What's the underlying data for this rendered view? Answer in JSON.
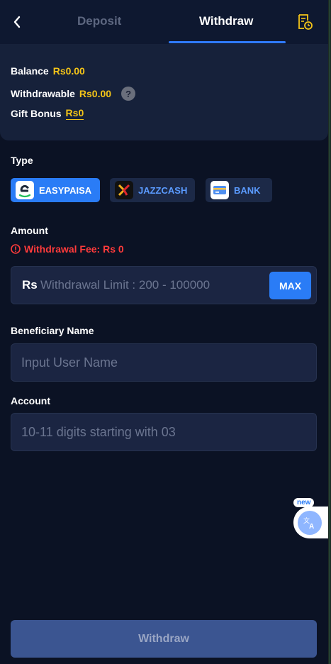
{
  "header": {
    "tabs": [
      {
        "label": "Deposit",
        "active": false
      },
      {
        "label": "Withdraw",
        "active": true
      }
    ],
    "back_icon": "chevron-left-icon",
    "record_icon": "withdraw-history-icon",
    "accent_color": "#2f7bff"
  },
  "balance": {
    "balance_label": "Balance",
    "balance_value": "Rs0.00",
    "withdrawable_label": "Withdrawable",
    "withdrawable_value": "Rs0.00",
    "help_glyph": "?",
    "gift_label": "Gift Bonus",
    "gift_value": "Rs0",
    "value_color": "#f5c518"
  },
  "type": {
    "label": "Type",
    "options": [
      {
        "label": "EASYPAISA",
        "selected": true
      },
      {
        "label": "JAZZCASH",
        "selected": false
      },
      {
        "label": "BANK",
        "selected": false
      }
    ]
  },
  "amount": {
    "label": "Amount",
    "fee_text": "Withdrawal Fee: Rs 0",
    "currency": "Rs",
    "placeholder": "Withdrawal Limit : 200 - 100000",
    "max_label": "MAX"
  },
  "beneficiary": {
    "label": "Beneficiary Name",
    "placeholder": "Input User Name"
  },
  "account": {
    "label": "Account",
    "placeholder": "10-11 digits starting with 03"
  },
  "translate_widget": {
    "badge": "new",
    "icon": "translate-icon"
  },
  "submit": {
    "label": "Withdraw"
  }
}
